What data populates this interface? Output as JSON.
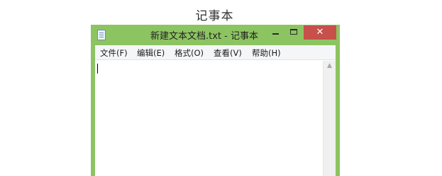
{
  "caption": "记事本",
  "window": {
    "title": "新建文本文档.txt - 记事本",
    "icon": "notepad-icon",
    "controls": {
      "minimize": "minimize-icon",
      "maximize": "maximize-icon",
      "close_glyph": "✕"
    }
  },
  "menu": {
    "items": [
      {
        "label": "文件(F)"
      },
      {
        "label": "编辑(E)"
      },
      {
        "label": "格式(O)"
      },
      {
        "label": "查看(V)"
      },
      {
        "label": "帮助(H)"
      }
    ]
  },
  "editor": {
    "value": ""
  },
  "scrollbar": {
    "up_glyph": "▲"
  },
  "colors": {
    "frame": "#8dc462",
    "close_button": "#c7504a",
    "menubar": "#f5f6f7"
  }
}
